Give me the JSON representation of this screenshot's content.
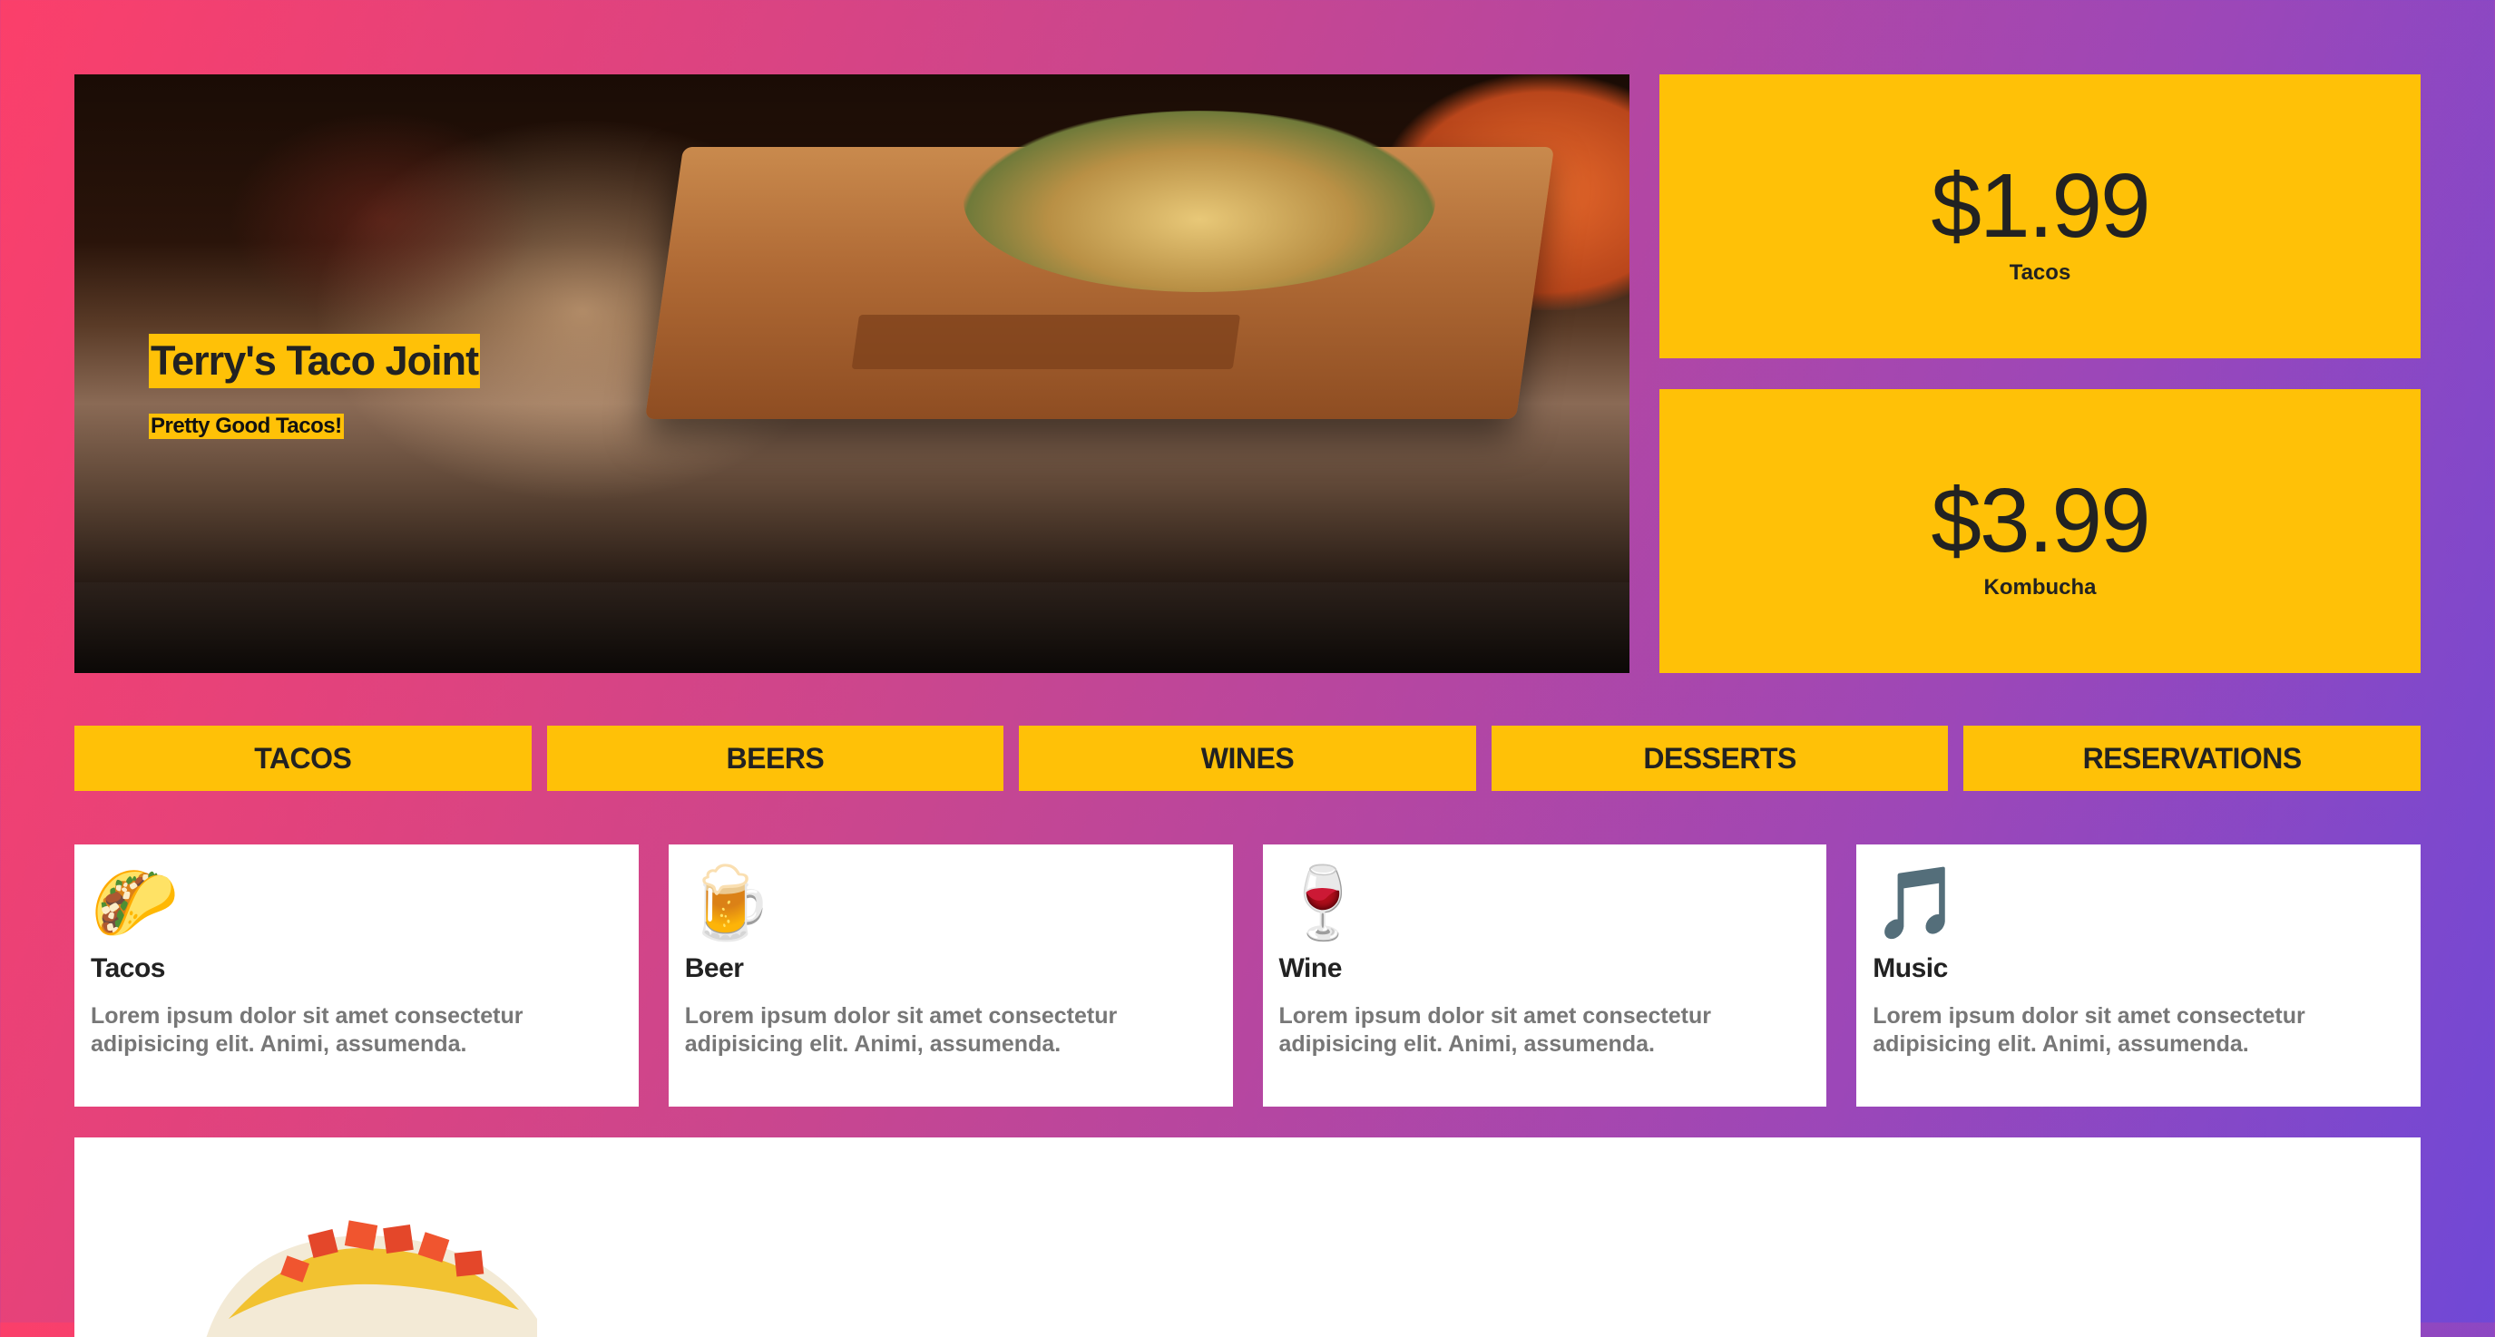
{
  "hero": {
    "title": "Terry's Taco Joint",
    "subtitle": "Pretty Good Tacos!"
  },
  "prices": [
    {
      "amount": "$1.99",
      "label": "Tacos"
    },
    {
      "amount": "$3.99",
      "label": "Kombucha"
    }
  ],
  "nav": {
    "items": [
      "TACOS",
      "BEERS",
      "WINES",
      "DESSERTS",
      "RESERVATIONS"
    ]
  },
  "features": [
    {
      "icon": "🌮",
      "icon_name": "taco-icon",
      "title": "Tacos",
      "text": "Lorem ipsum dolor sit amet consectetur adipisicing elit. Animi, assumenda."
    },
    {
      "icon": "🍺",
      "icon_name": "beer-icon",
      "title": "Beer",
      "text": "Lorem ipsum dolor sit amet consectetur adipisicing elit. Animi, assumenda."
    },
    {
      "icon": "🍷",
      "icon_name": "wine-icon",
      "title": "Wine",
      "text": "Lorem ipsum dolor sit amet consectetur adipisicing elit. Animi, assumenda."
    },
    {
      "icon": "🎵",
      "icon_name": "music-icon",
      "title": "Music",
      "text": "Lorem ipsum dolor sit amet consectetur adipisicing elit. Animi, assumenda."
    }
  ],
  "colors": {
    "accent": "#ffc107",
    "gradient_start": "#fb3f6a",
    "gradient_end": "#7048d6"
  }
}
